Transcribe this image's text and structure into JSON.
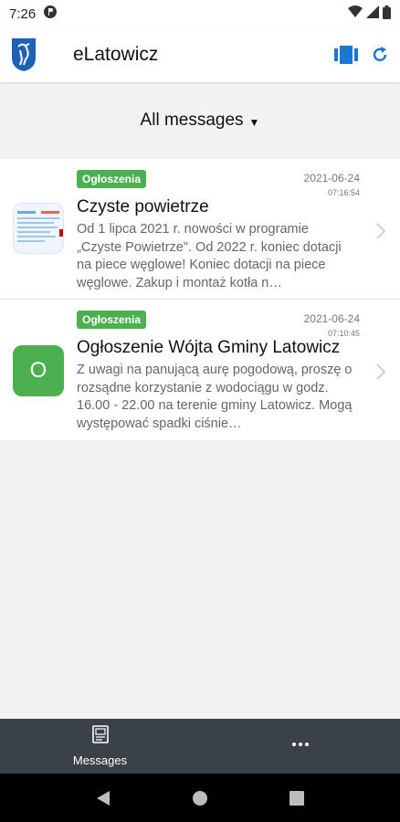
{
  "status_bar": {
    "time": "7:26"
  },
  "app": {
    "title": "eLatowicz",
    "accent": "#1976d2"
  },
  "filter": {
    "label": "All messages"
  },
  "messages": [
    {
      "category": "Ogłoszenia",
      "date": "2021-06-24",
      "time": "07:16:54",
      "title": "Czyste powietrze",
      "preview": "Od 1 lipca 2021 r. nowości w programie „Czyste Powietrze\". Od 2022 r. koniec dotacji na piece węglowe! Koniec dotacji na piece węglowe. Zakup i montaż kotła n…",
      "thumbnail": "document-thumbnail"
    },
    {
      "category": "Ogłoszenia",
      "date": "2021-06-24",
      "time": "07:10:45",
      "title": "Ogłoszenie Wójta Gminy Latowicz",
      "preview": "Z uwagi na panującą aurę pogodową, proszę o rozsądne korzystanie z wodociągu w godz. 16.00 - 22.00 na terenie gminy Latowicz. Mogą występować spadki ciśnie…",
      "thumbnail_letter": "O"
    }
  ],
  "tabs": [
    {
      "label": "Messages",
      "icon": "messages-icon"
    },
    {
      "label": "",
      "icon": "more-icon"
    }
  ],
  "colors": {
    "badge": "#4caf50",
    "tab_bar": "#3b4148"
  }
}
